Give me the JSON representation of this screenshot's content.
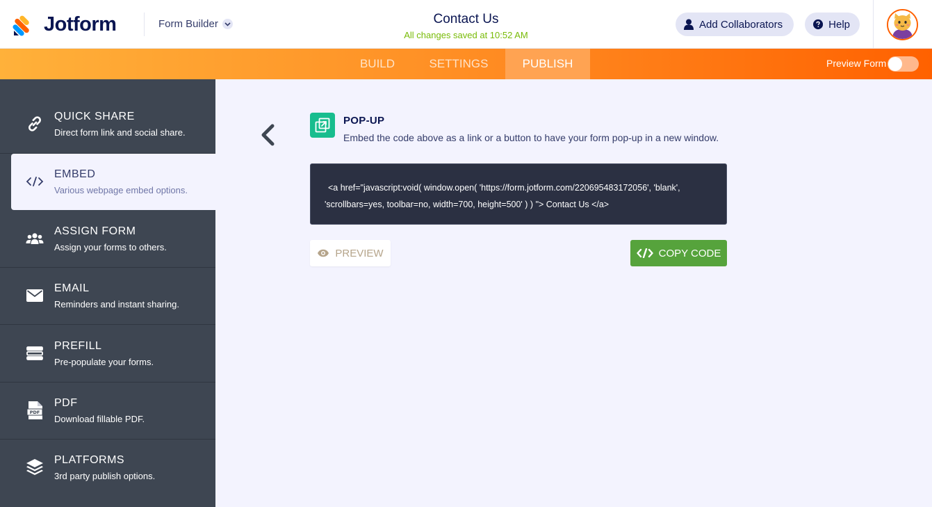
{
  "header": {
    "logo_text": "Jotform",
    "builder_label": "Form Builder",
    "form_title": "Contact Us",
    "save_status": "All changes saved at 10:52 AM",
    "collaborators_label": "Add Collaborators",
    "help_label": "Help"
  },
  "navbar": {
    "tabs": [
      {
        "label": "BUILD",
        "active": false
      },
      {
        "label": "SETTINGS",
        "active": false
      },
      {
        "label": "PUBLISH",
        "active": true
      }
    ],
    "preview_form_label": "Preview Form",
    "preview_toggle_on": false
  },
  "sidebar": {
    "items": [
      {
        "title": "QUICK SHARE",
        "subtitle": "Direct form link and social share.",
        "icon": "link-icon",
        "active": false
      },
      {
        "title": "EMBED",
        "subtitle": "Various webpage embed options.",
        "icon": "code-icon",
        "active": true
      },
      {
        "title": "ASSIGN FORM",
        "subtitle": "Assign your forms to others.",
        "icon": "users-icon",
        "active": false
      },
      {
        "title": "EMAIL",
        "subtitle": "Reminders and instant sharing.",
        "icon": "envelope-icon",
        "active": false
      },
      {
        "title": "PREFILL",
        "subtitle": "Pre-populate your forms.",
        "icon": "prefill-icon",
        "active": false
      },
      {
        "title": "PDF",
        "subtitle": "Download fillable PDF.",
        "icon": "pdf-icon",
        "active": false
      },
      {
        "title": "PLATFORMS",
        "subtitle": "3rd party publish options.",
        "icon": "layers-icon",
        "active": false
      }
    ]
  },
  "content": {
    "section_title": "POP-UP",
    "section_description": "Embed the code above as a link or a button to have your form pop-up in a new window.",
    "code_line_1": "<a href=\"javascript:void( window.open( 'https://form.jotform.com/220695483172056', 'blank',",
    "code_line_2": "'scrollbars=yes, toolbar=no, width=700, height=500' ) ) \"> Contact Us </a>",
    "preview_button": "PREVIEW",
    "copy_button": "COPY CODE"
  },
  "colors": {
    "brand_navy": "#0a1551",
    "brand_orange": "#ff6100",
    "saved_green": "#78bb07",
    "copy_green": "#56a33c",
    "sidebar_bg": "#3e4652",
    "code_bg": "#2b3042",
    "popup_icon_bg": "#18bd8e"
  },
  "pdf_icon_text": "PDF"
}
